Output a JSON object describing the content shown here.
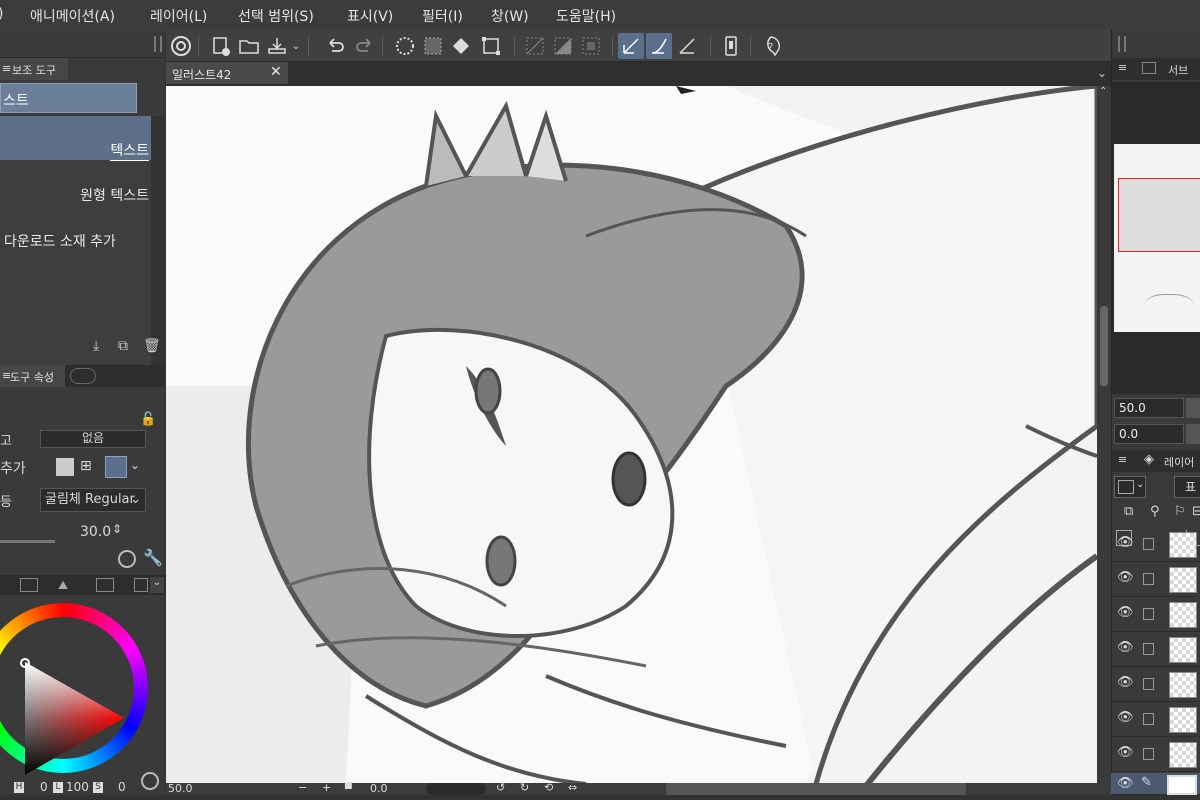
{
  "menubar": {
    "items": [
      ")",
      "애니메이션(A)",
      "레이어(L)",
      "선택 범위(S)",
      "표시(V)",
      "필터(I)",
      "창(W)",
      "도움말(H)"
    ]
  },
  "document": {
    "tab_title": "일러스트42"
  },
  "left_panel": {
    "sub_tool_tab": "보조 도구",
    "selected_group": "스트",
    "items": [
      "텍스트",
      "원형 텍스트",
      "다운로드 소재 추가"
    ],
    "tool_property_tab": "도구 속성",
    "prop_partial_label": "고",
    "prop_value": "없음",
    "add_label": "추가",
    "font_label": "등",
    "font_value": "굴림체 Regular",
    "size_value": "30.0",
    "color_labels": {
      "h": "H",
      "h_val": "0",
      "l": "L",
      "l_val": "100",
      "s": "S",
      "s_val": "0"
    }
  },
  "right_panel": {
    "nav_tab": "서브",
    "zoom_value": "50.0",
    "rotation_value": "0.0",
    "layer_tab": "레이어",
    "blend_partial": "표"
  },
  "statusbar": {
    "zoom": "50.0",
    "rotation": "0.0"
  },
  "colors": {
    "accent_selected": "#5a6f8c",
    "color_wheel_indicator": "#ffffff"
  }
}
